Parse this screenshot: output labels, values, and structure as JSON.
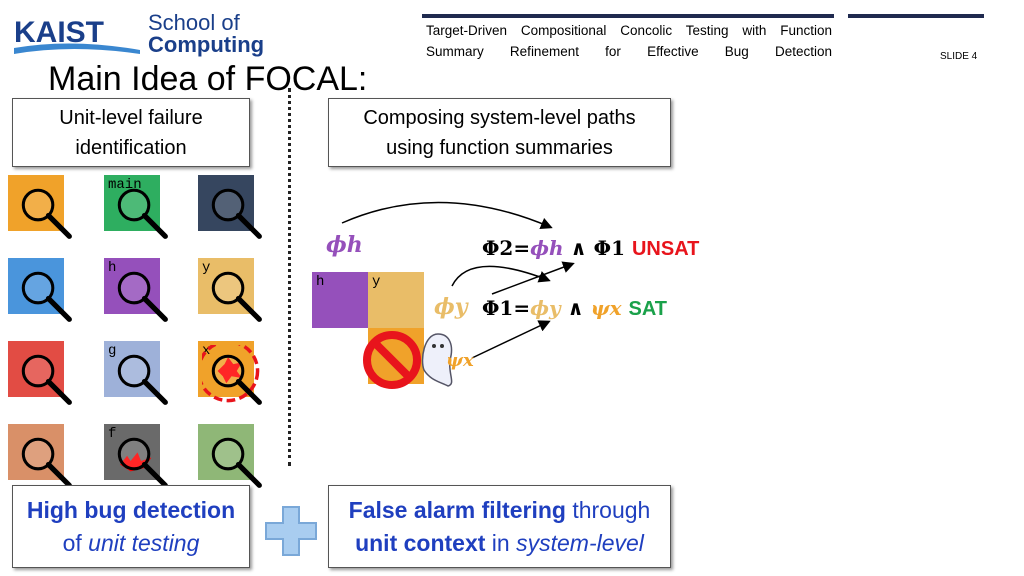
{
  "header": {
    "logo_text": "KAIST",
    "school_line1": "School of",
    "school_line2": "Computing",
    "subtitle": "Target-Driven Compositional Concolic Testing with Function Summary Refinement for Effective Bug Detection",
    "slide_number": "SLIDE 4"
  },
  "title": "Main Idea of FOCAL:",
  "left_box": {
    "line1": "Unit-level failure",
    "line2": "identification"
  },
  "right_box": {
    "line1": "Composing system-level paths",
    "line2": "using function summaries"
  },
  "pieces": [
    {
      "color": "#f0a22a",
      "label": ""
    },
    {
      "color": "#2eae60",
      "label": "main"
    },
    {
      "color": "#36465f",
      "label": ""
    },
    {
      "color": "#4a95dc",
      "label": ""
    },
    {
      "color": "#9550bb",
      "label": "h"
    },
    {
      "color": "#e9bd68",
      "label": "y"
    },
    {
      "color": "#e24c44",
      "label": ""
    },
    {
      "color": "#9eb1d9",
      "label": "g"
    },
    {
      "color": "#f0a22a",
      "label": "x"
    },
    {
      "color": "#d99068",
      "label": ""
    },
    {
      "color": "#6a6a6a",
      "label": "f"
    },
    {
      "color": "#8fb777",
      "label": ""
    }
  ],
  "diagram": {
    "piece_h": "h",
    "piece_y": "y",
    "phi_h": "ϕh",
    "phi_y": "ϕy",
    "psi_x": "ψx",
    "eq2": {
      "lhs": "Φ2",
      "phi": "ϕh",
      "and": "∧",
      "rhs": "Φ1",
      "result": "UNSAT"
    },
    "eq1": {
      "lhs": "Φ1",
      "phi": "ϕy",
      "and": "∧",
      "rhs": "ψx",
      "result": "SAT"
    },
    "colors": {
      "purple": "#9550bb",
      "orange": "#f0a22a",
      "unsat": "#e8141c",
      "sat": "#1aa14a"
    }
  },
  "bottom_left": {
    "bold": "High bug detection",
    "pre": "of ",
    "italic": "unit testing"
  },
  "bottom_right": {
    "bold1": "False alarm filtering",
    "text1": " through",
    "bold2": "unit context",
    "text2": " in ",
    "italic": "system-level"
  }
}
